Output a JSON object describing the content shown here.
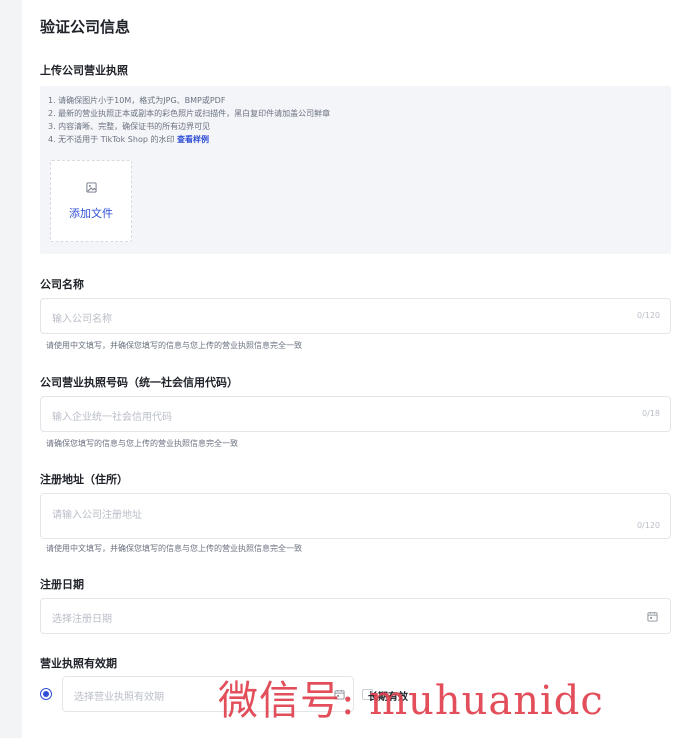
{
  "page": {
    "title": "验证公司信息"
  },
  "upload": {
    "label": "上传公司营业执照",
    "instructions": [
      "1. 请确保图片小于10M，格式为JPG、BMP或PDF",
      "2. 最新的营业执照正本或副本的彩色照片或扫描件，黑白复印件请加盖公司鲜章",
      "3. 内容清晰、完整，确保证书的所有边界可见",
      "4. 无不适用于 TikTok Shop 的水印 "
    ],
    "example_link": "查看样例",
    "add_file_label": "添加文件"
  },
  "company_name": {
    "label": "公司名称",
    "placeholder": "输入公司名称",
    "counter": "0/120",
    "hint": "请使用中文填写，并确保您填写的信息与您上传的营业执照信息完全一致"
  },
  "license_number": {
    "label": "公司营业执照号码（统一社会信用代码）",
    "placeholder": "输入企业统一社会信用代码",
    "counter": "0/18",
    "hint": "请确保您填写的信息与您上传的营业执照信息完全一致"
  },
  "address": {
    "label": "注册地址（住所）",
    "placeholder": "请输入公司注册地址",
    "counter": "0/120",
    "hint": "请使用中文填写，并确保您填写的信息与您上传的营业执照信息完全一致"
  },
  "reg_date": {
    "label": "注册日期",
    "placeholder": "选择注册日期"
  },
  "validity": {
    "label": "营业执照有效期",
    "placeholder": "选择营业执照有效期",
    "long_term_label": "长期有效"
  },
  "watermark": {
    "text": "微信号: muhuanidc"
  },
  "colors": {
    "accent": "#2f4fd6",
    "watermark": "#e0414e"
  }
}
